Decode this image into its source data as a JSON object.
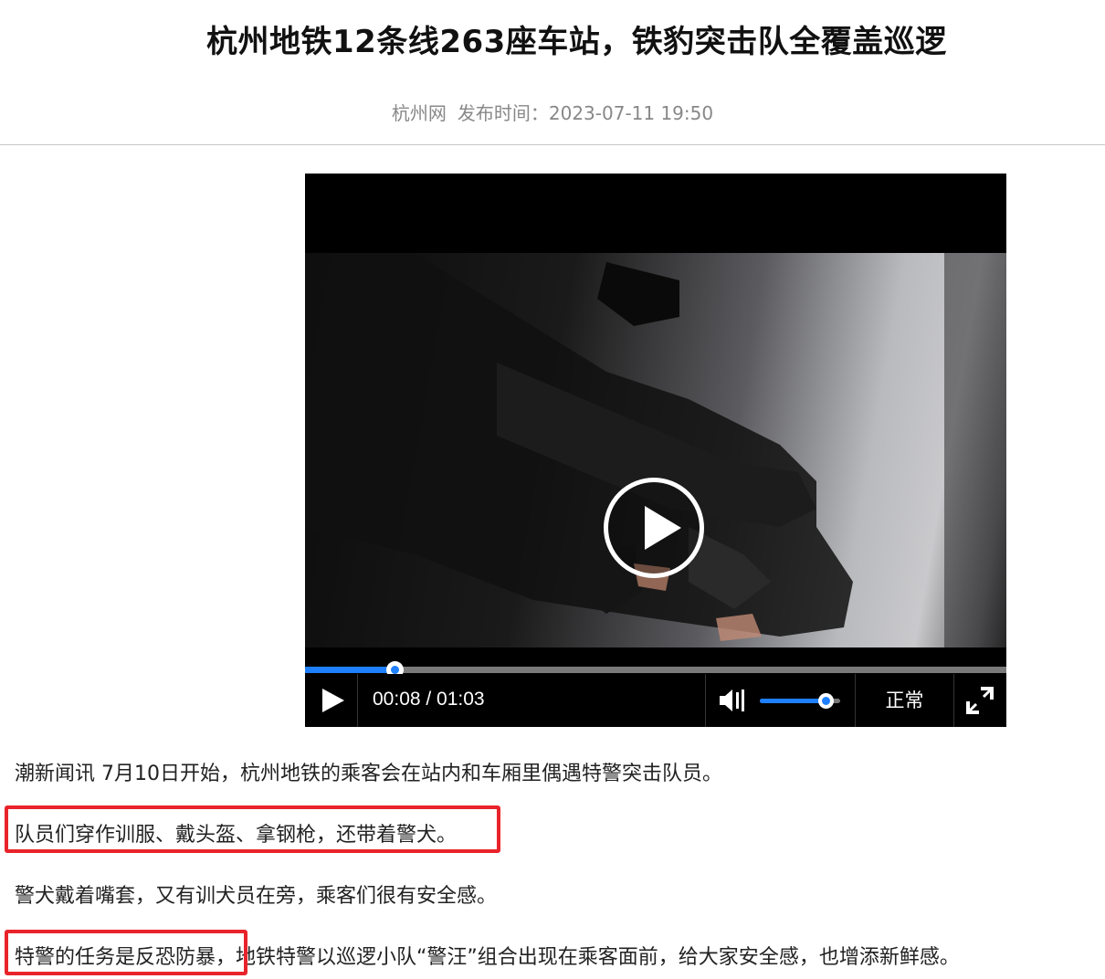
{
  "article": {
    "title": "杭州地铁12条线263座车站，铁豹突击队全覆盖巡逻",
    "source": "杭州网",
    "published_label": "发布时间：2023-07-11 19:50"
  },
  "player": {
    "time_display": "00:08 / 01:03",
    "progress": 0.127,
    "volume": 0.82,
    "speed_label": "正常",
    "icons": {
      "center": "play-circle-icon",
      "play": "play-icon",
      "volume": "volume-icon",
      "fullscreen": "fullscreen-icon"
    },
    "accent_color": "#1e7fff"
  },
  "body": {
    "p1": "潮新闻讯 7月10日开始，杭州地铁的乘客会在站内和车厢里偶遇特警突击队员。",
    "p2": "队员们穿作训服、戴头盔、拿钢枪，还带着警犬。",
    "p3": "警犬戴着嘴套，又有训犬员在旁，乘客们很有安全感。",
    "p4_highlight": "特警的任务是反恐防暴",
    "p4_rest": "，地铁特警以巡逻小队“警汪”组合出现在乘客面前，给大家安全感，也增添新鲜感。"
  },
  "highlight_color": "#e8232a"
}
